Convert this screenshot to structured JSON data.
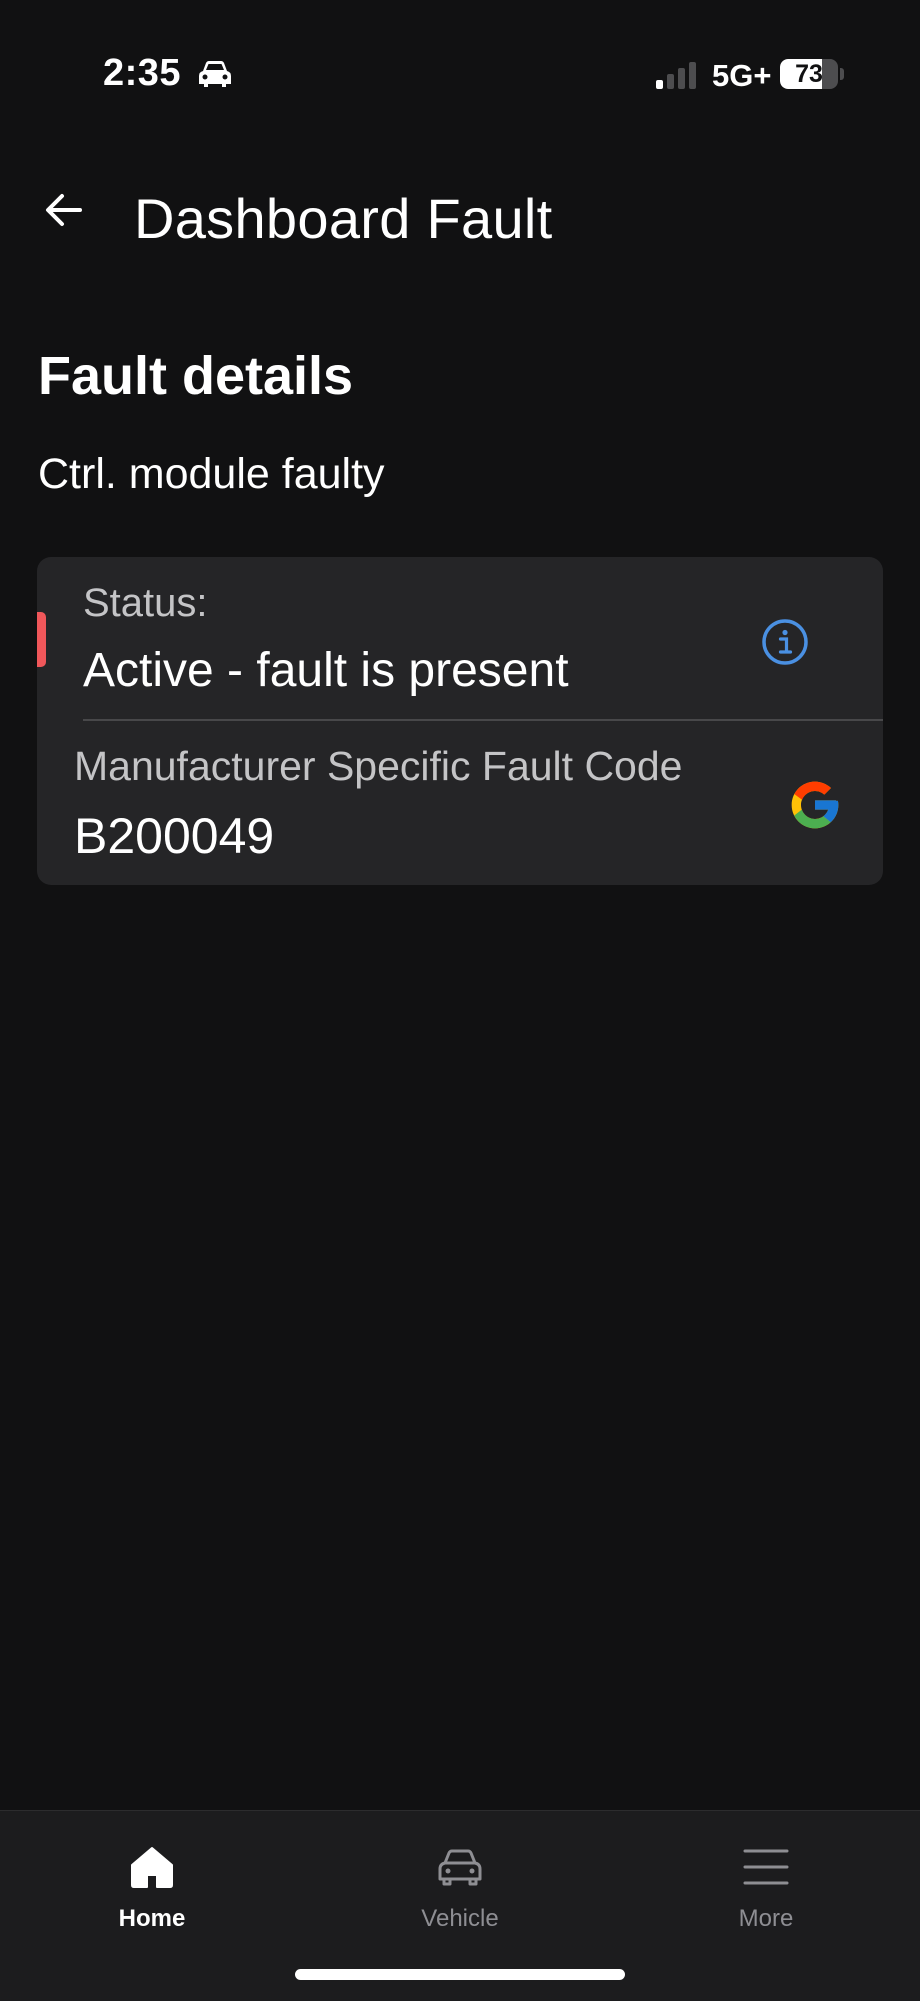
{
  "status_bar": {
    "time": "2:35",
    "network": "5G+",
    "battery_level": "73",
    "battery_fraction": 0.73
  },
  "header": {
    "title": "Dashboard Fault"
  },
  "fault": {
    "section_title": "Fault details",
    "description": "Ctrl. module faulty",
    "status_label": "Status:",
    "status_value": "Active - fault is present",
    "status_color": "#f0575a",
    "code_label": "Manufacturer Specific Fault Code",
    "code_value": "B200049"
  },
  "colors": {
    "background": "#111112",
    "card": "#252527",
    "info_accent": "#4a90e2",
    "nav_background": "#1c1c1e"
  },
  "icons": {
    "back": "arrow-left-icon",
    "info": "info-circle-icon",
    "google": "google-icon",
    "home": "home-icon",
    "vehicle": "car-icon",
    "more": "menu-icon"
  },
  "bottom_nav": {
    "items": [
      {
        "label": "Home",
        "active": true
      },
      {
        "label": "Vehicle",
        "active": false
      },
      {
        "label": "More",
        "active": false
      }
    ]
  }
}
